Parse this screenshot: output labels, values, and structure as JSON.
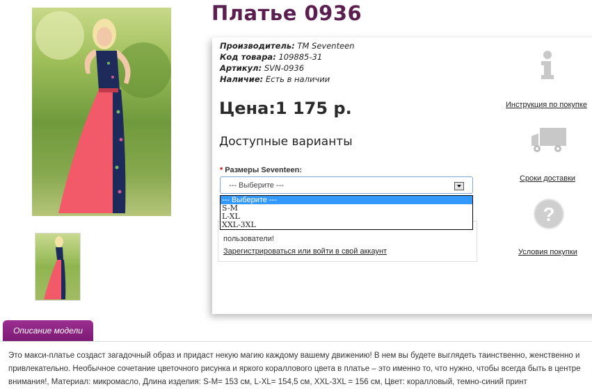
{
  "product": {
    "title": "Платье 0936",
    "specs": [
      {
        "label": "Производитель:",
        "value": "TM Seventeen"
      },
      {
        "label": "Код товара:",
        "value": "109885-31"
      },
      {
        "label": "Артикул:",
        "value": "SVN-0936"
      },
      {
        "label": "Наличие:",
        "value": "Есть в наличии"
      }
    ],
    "price": "Цена:1 175 р."
  },
  "options": {
    "heading": "Доступные варианты",
    "required_mark": "*",
    "size_label": "Размеры Seventeen:",
    "select_value": "--- Выберите ---",
    "dropdown": [
      "--- Выберите ---",
      "S-M",
      "L-XL",
      "XXL-3XL"
    ]
  },
  "login_notice": {
    "text": "пользователи!",
    "link": "Зарегистрироваться или войти в свой аккаунт"
  },
  "side_links": {
    "instruction": "Инструкция по покупке",
    "delivery": "Сроки доставки",
    "terms": "Условия покупки"
  },
  "description": {
    "tab": "Описание модели",
    "text": "Это макси-платье создаст загадочный образ и придаст некую магию каждому вашему движению! В нем вы будете выглядеть таинственно, женственно и привлекательно. Необычное сочетание цветочного рисунка и яркого кораллового цвета в платье – это именно то, что нужно, чтобы всегда быть в центре внимания!, Материал: микромасло, Длина изделия: S-M= 153 см, L-XL= 154,5 см, XXL-3XL = 156 см, Цвет: коралловый, темно-синий принт"
  },
  "colors": {
    "title": "#5a1f4f",
    "tab": "#8a2382",
    "dropdown_selected": "#3399ff"
  }
}
